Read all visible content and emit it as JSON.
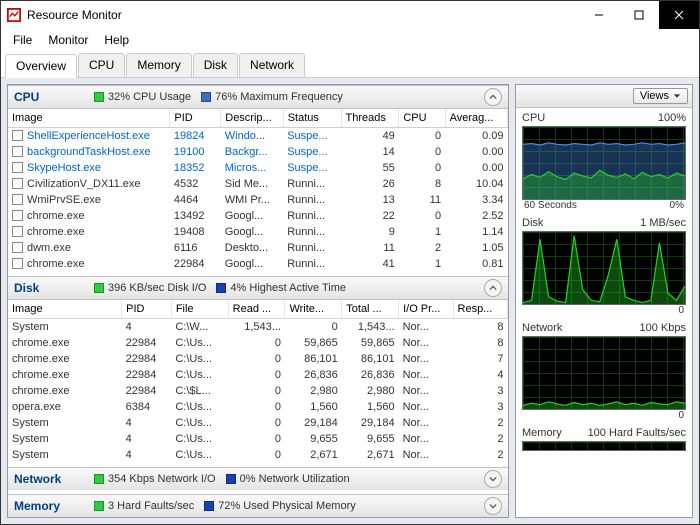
{
  "window": {
    "title": "Resource Monitor"
  },
  "menu": [
    "File",
    "Monitor",
    "Help"
  ],
  "tabs": [
    "Overview",
    "CPU",
    "Memory",
    "Disk",
    "Network"
  ],
  "tabs_active": 0,
  "right": {
    "views": "Views",
    "sections": [
      {
        "title": "CPU",
        "right": "100%",
        "bottom_left": "60 Seconds",
        "bottom_right": "0%"
      },
      {
        "title": "Disk",
        "right": "1 MB/sec",
        "bottom_left": "",
        "bottom_right": "0"
      },
      {
        "title": "Network",
        "right": "100 Kbps",
        "bottom_left": "",
        "bottom_right": "0"
      },
      {
        "title": "Memory",
        "right": "100 Hard Faults/sec",
        "bottom_left": "",
        "bottom_right": ""
      }
    ]
  },
  "panels": {
    "cpu": {
      "name": "CPU",
      "m1": "32% CPU Usage",
      "c1": "#2ecc40",
      "m2": "76% Maximum Frequency",
      "c2": "#3b6fb6",
      "cols": [
        "Image",
        "PID",
        "Descrip...",
        "Status",
        "Threads",
        "CPU",
        "Averag..."
      ],
      "rows": [
        {
          "link": true,
          "img": "ShellExperienceHost.exe",
          "pid": "19824",
          "desc": "Windo...",
          "stat": "Suspe...",
          "thr": "49",
          "cpu": "0",
          "avg": "0.09"
        },
        {
          "link": true,
          "img": "backgroundTaskHost.exe",
          "pid": "19100",
          "desc": "Backgr...",
          "stat": "Suspe...",
          "thr": "14",
          "cpu": "0",
          "avg": "0.00"
        },
        {
          "link": true,
          "img": "SkypeHost.exe",
          "pid": "18352",
          "desc": "Micros...",
          "stat": "Suspe...",
          "thr": "55",
          "cpu": "0",
          "avg": "0.00"
        },
        {
          "link": false,
          "img": "CivilizationV_DX11.exe",
          "pid": "4532",
          "desc": "Sid Me...",
          "stat": "Runni...",
          "thr": "26",
          "cpu": "8",
          "avg": "10.04"
        },
        {
          "link": false,
          "img": "WmiPrvSE.exe",
          "pid": "4464",
          "desc": "WMI Pr...",
          "stat": "Runni...",
          "thr": "13",
          "cpu": "11",
          "avg": "3.34"
        },
        {
          "link": false,
          "img": "chrome.exe",
          "pid": "13492",
          "desc": "Googl...",
          "stat": "Runni...",
          "thr": "22",
          "cpu": "0",
          "avg": "2.52"
        },
        {
          "link": false,
          "img": "chrome.exe",
          "pid": "19408",
          "desc": "Googl...",
          "stat": "Runni...",
          "thr": "9",
          "cpu": "1",
          "avg": "1.14"
        },
        {
          "link": false,
          "img": "dwm.exe",
          "pid": "6116",
          "desc": "Deskto...",
          "stat": "Runni...",
          "thr": "11",
          "cpu": "2",
          "avg": "1.05"
        },
        {
          "link": false,
          "img": "chrome.exe",
          "pid": "22984",
          "desc": "Googl...",
          "stat": "Runni...",
          "thr": "41",
          "cpu": "1",
          "avg": "0.81"
        }
      ]
    },
    "disk": {
      "name": "Disk",
      "m1": "396 KB/sec Disk I/O",
      "c1": "#2ecc40",
      "m2": "4% Highest Active Time",
      "c2": "#1a3fb0",
      "cols": [
        "Image",
        "PID",
        "File",
        "Read ...",
        "Write...",
        "Total ...",
        "I/O Pr...",
        "Resp..."
      ],
      "rows": [
        {
          "img": "System",
          "pid": "4",
          "file": "C:\\W...",
          "r": "1,543...",
          "w": "0",
          "t": "1,543...",
          "p": "Nor...",
          "resp": "8"
        },
        {
          "img": "chrome.exe",
          "pid": "22984",
          "file": "C:\\Us...",
          "r": "0",
          "w": "59,865",
          "t": "59,865",
          "p": "Nor...",
          "resp": "8"
        },
        {
          "img": "chrome.exe",
          "pid": "22984",
          "file": "C:\\Us...",
          "r": "0",
          "w": "86,101",
          "t": "86,101",
          "p": "Nor...",
          "resp": "7"
        },
        {
          "img": "chrome.exe",
          "pid": "22984",
          "file": "C:\\Us...",
          "r": "0",
          "w": "26,836",
          "t": "26,836",
          "p": "Nor...",
          "resp": "4"
        },
        {
          "img": "chrome.exe",
          "pid": "22984",
          "file": "C:\\$L...",
          "r": "0",
          "w": "2,980",
          "t": "2,980",
          "p": "Nor...",
          "resp": "3"
        },
        {
          "img": "opera.exe",
          "pid": "6384",
          "file": "C:\\Us...",
          "r": "0",
          "w": "1,560",
          "t": "1,560",
          "p": "Nor...",
          "resp": "3"
        },
        {
          "img": "System",
          "pid": "4",
          "file": "C:\\Us...",
          "r": "0",
          "w": "29,184",
          "t": "29,184",
          "p": "Nor...",
          "resp": "2"
        },
        {
          "img": "System",
          "pid": "4",
          "file": "C:\\Us...",
          "r": "0",
          "w": "9,655",
          "t": "9,655",
          "p": "Nor...",
          "resp": "2"
        },
        {
          "img": "System",
          "pid": "4",
          "file": "C:\\Us...",
          "r": "0",
          "w": "2,671",
          "t": "2,671",
          "p": "Nor...",
          "resp": "2"
        }
      ]
    },
    "net": {
      "name": "Network",
      "m1": "354 Kbps Network I/O",
      "c1": "#2ecc40",
      "m2": "0% Network Utilization",
      "c2": "#1a3fb0"
    },
    "mem": {
      "name": "Memory",
      "m1": "3 Hard Faults/sec",
      "c1": "#2ecc40",
      "m2": "72% Used Physical Memory",
      "c2": "#1a3fb0"
    }
  },
  "chart_data": [
    {
      "type": "line",
      "title": "CPU",
      "ylim": [
        0,
        100
      ],
      "x_seconds": [
        60,
        0
      ],
      "series": [
        {
          "name": "maxfreq",
          "color": "#4b8ef0",
          "values": [
            76,
            77,
            75,
            78,
            76,
            75,
            77,
            76,
            75,
            78,
            76,
            77,
            75,
            76,
            78,
            76,
            77,
            75,
            76,
            78
          ]
        },
        {
          "name": "usage",
          "color": "#28d028",
          "values": [
            28,
            34,
            30,
            38,
            31,
            27,
            36,
            32,
            29,
            40,
            33,
            30,
            35,
            28,
            37,
            31,
            34,
            29,
            36,
            32
          ]
        }
      ]
    },
    {
      "type": "line",
      "title": "Disk",
      "ylim": [
        0,
        1
      ],
      "x_seconds": [
        60,
        0
      ],
      "series": [
        {
          "name": "disk-io",
          "color": "#28d028",
          "values": [
            0.02,
            0.05,
            0.9,
            0.1,
            0.04,
            0.02,
            0.95,
            0.2,
            0.05,
            0.03,
            0.4,
            0.9,
            0.1,
            0.05,
            0.02,
            0.05,
            0.85,
            0.15,
            0.05,
            0.25
          ]
        }
      ]
    },
    {
      "type": "line",
      "title": "Network",
      "ylim": [
        0,
        100
      ],
      "x_seconds": [
        60,
        0
      ],
      "series": [
        {
          "name": "net-io",
          "color": "#28d028",
          "values": [
            5,
            8,
            6,
            10,
            7,
            5,
            9,
            6,
            8,
            5,
            7,
            10,
            6,
            8,
            5,
            9,
            7,
            6,
            10,
            8
          ]
        }
      ]
    }
  ]
}
